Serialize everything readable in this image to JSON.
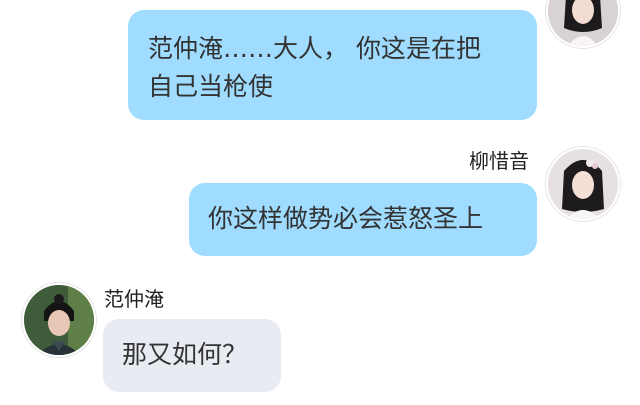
{
  "messages": [
    {
      "side": "right",
      "sender": "",
      "lines": [
        "范仲淹……大人， 你这是在把",
        "自己当枪使"
      ],
      "avatar": "female-avatar-icon"
    },
    {
      "side": "right",
      "sender": "柳惜音",
      "lines": [
        "你这样做势必会惹怒圣上"
      ],
      "avatar": "female-avatar-icon"
    },
    {
      "side": "left",
      "sender": "范仲淹",
      "lines": [
        "那又如何？"
      ],
      "avatar": "male-avatar-icon"
    }
  ],
  "colors": {
    "right_bubble": "#9fdcff",
    "left_bubble": "#e8ebf1",
    "text": "#333333",
    "background": "#ffffff"
  }
}
